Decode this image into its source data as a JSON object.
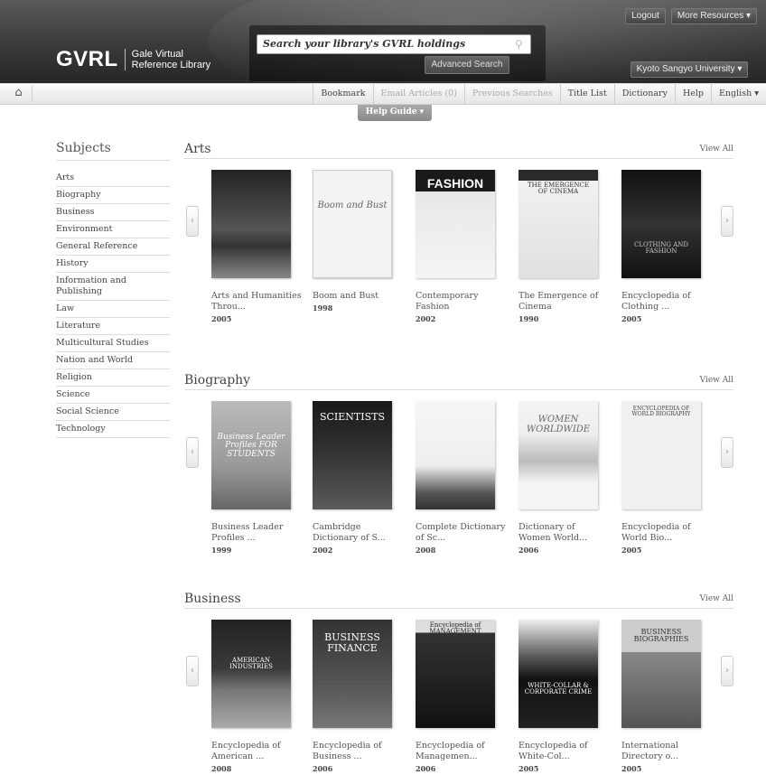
{
  "header": {
    "logo_main": "GVRL",
    "logo_sub_line1": "Gale Virtual",
    "logo_sub_line2": "Reference Library",
    "search_placeholder": "Search your library's GVRL holdings",
    "advanced_search": "Advanced Search",
    "logout": "Logout",
    "more_resources": "More Resources ▾",
    "institution": "Kyoto Sangyo University ▾"
  },
  "toolbar": {
    "items": [
      {
        "label": "Bookmark",
        "disabled": false
      },
      {
        "label": "Email Articles (0)",
        "disabled": true
      },
      {
        "label": "Previous Searches",
        "disabled": true
      },
      {
        "label": "Title List",
        "disabled": false
      },
      {
        "label": "Dictionary",
        "disabled": false
      },
      {
        "label": "Help",
        "disabled": false
      },
      {
        "label": "English ▾",
        "disabled": false
      }
    ],
    "help_guide": "Help Guide ▾"
  },
  "sidebar": {
    "title": "Subjects",
    "items": [
      "Arts",
      "Biography",
      "Business",
      "Environment",
      "General Reference",
      "History",
      "Information and Publishing",
      "Law",
      "Literature",
      "Multicultural Studies",
      "Nation and World",
      "Religion",
      "Science",
      "Social Science",
      "Technology"
    ]
  },
  "sections": [
    {
      "title": "Arts",
      "view_all": "View All",
      "books": [
        {
          "title": "Arts and Humanities Throu...",
          "year": "2005",
          "cover": "dark-statue"
        },
        {
          "title": "Boom and Bust",
          "year": "1998",
          "cover": "boom-and-bust",
          "cover_text": "Boom and Bust"
        },
        {
          "title": "Contemporary Fashion",
          "year": "2002",
          "cover": "fashion",
          "cover_text": "FASHION"
        },
        {
          "title": "The Emergence of Cinema",
          "year": "1990",
          "cover": "cinema",
          "cover_text": "THE EMERGENCE OF CINEMA"
        },
        {
          "title": "Encyclopedia of Clothing ...",
          "year": "2005",
          "cover": "clothing",
          "cover_text": "CLOTHING AND FASHION"
        }
      ]
    },
    {
      "title": "Biography",
      "view_all": "View All",
      "books": [
        {
          "title": "Business Leader Profiles ...",
          "year": "1999",
          "cover": "business-leader",
          "cover_text": "Business Leader Profiles FOR STUDENTS"
        },
        {
          "title": "Cambridge Dictionary of S...",
          "year": "2002",
          "cover": "scientists",
          "cover_text": "SCIENTISTS"
        },
        {
          "title": "Complete Dictionary of Sc...",
          "year": "2008",
          "cover": "complete-dictionary",
          "cover_text": ""
        },
        {
          "title": "Dictionary of Women World...",
          "year": "2006",
          "cover": "women",
          "cover_text": "WOMEN WORLDWIDE"
        },
        {
          "title": "Encyclopedia of World Bio...",
          "year": "2005",
          "cover": "world-bio",
          "cover_text": "ENCYCLOPEDIA OF WORLD BIOGRAPHY"
        }
      ]
    },
    {
      "title": "Business",
      "view_all": "View All",
      "books": [
        {
          "title": "Encyclopedia of American ...",
          "year": "2008",
          "cover": "american-industries",
          "cover_text": "AMERICAN INDUSTRIES"
        },
        {
          "title": "Encyclopedia of Business ...",
          "year": "2006",
          "cover": "business-finance",
          "cover_text": "BUSINESS FINANCE"
        },
        {
          "title": "Encyclopedia of Managemen...",
          "year": "2006",
          "cover": "management",
          "cover_text": "Encyclopedia of MANAGEMENT"
        },
        {
          "title": "Encyclopedia of White-Col...",
          "year": "2005",
          "cover": "white-collar",
          "cover_text": "WHITE-COLLAR & CORPORATE CRIME"
        },
        {
          "title": "International Directory o...",
          "year": "2005",
          "cover": "directory",
          "cover_text": "BUSINESS BIOGRAPHIES"
        }
      ]
    }
  ]
}
